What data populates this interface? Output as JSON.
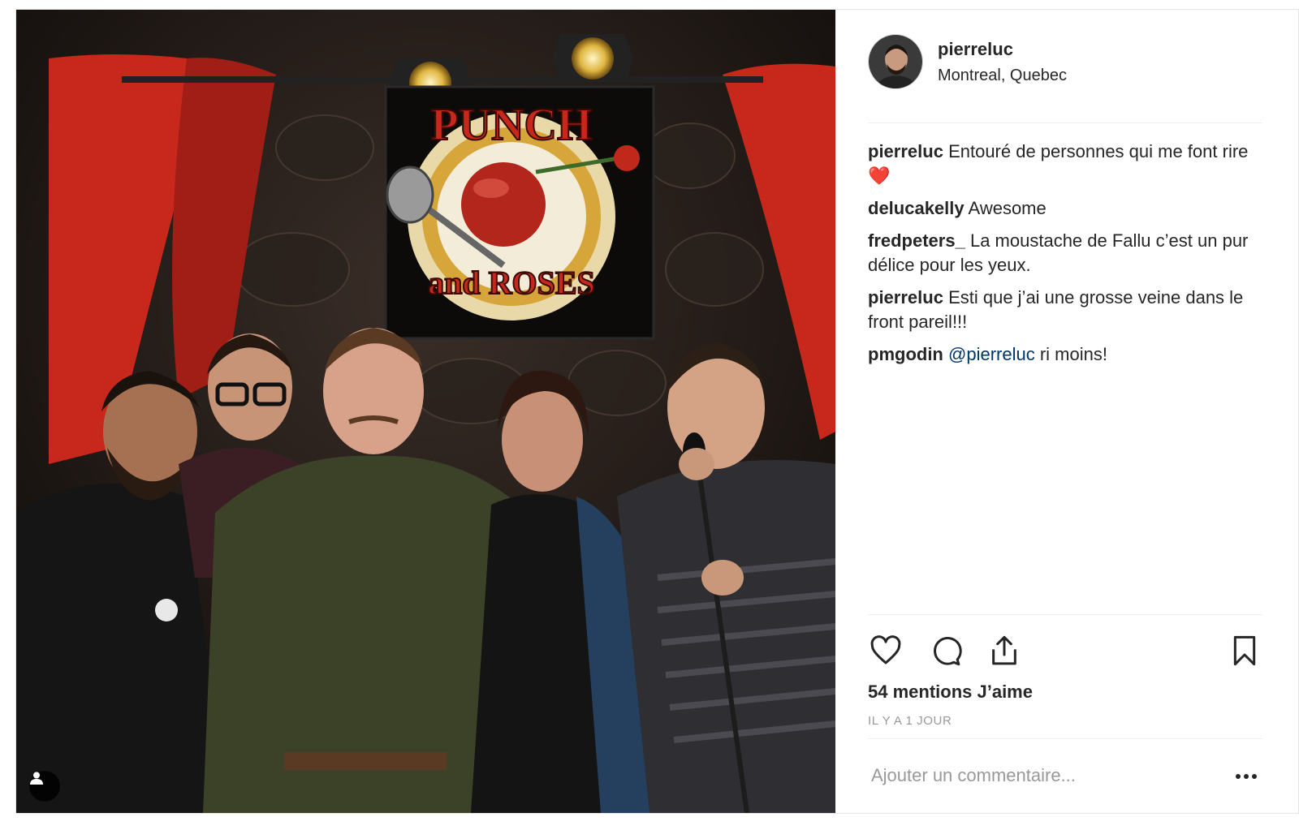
{
  "post": {
    "username": "pierreluc",
    "location": "Montreal, Quebec",
    "sign_text_top": "PUNCH",
    "sign_text_bottom": "and ROSES",
    "comments": [
      {
        "user": "pierreluc",
        "text": "Entouré de personnes qui me font rire",
        "emoji": "❤️"
      },
      {
        "user": "delucakelly",
        "text": "Awesome"
      },
      {
        "user": "fredpeters_",
        "text": "La moustache de Fallu c’est un pur délice pour les yeux."
      },
      {
        "user": "pierreluc",
        "text": "Esti que j’ai une grosse veine dans le front pareil!!!"
      },
      {
        "user": "pmgodin",
        "mention": "@pierreluc",
        "text": "ri moins!"
      }
    ],
    "likes": "54 mentions J’aime",
    "timestamp": "IL Y A 1 JOUR",
    "comment_placeholder": "Ajouter un commentaire...",
    "icons": [
      "heart-icon",
      "comment-icon",
      "share-icon",
      "bookmark-icon",
      "more-icon",
      "user-tag-icon"
    ]
  }
}
